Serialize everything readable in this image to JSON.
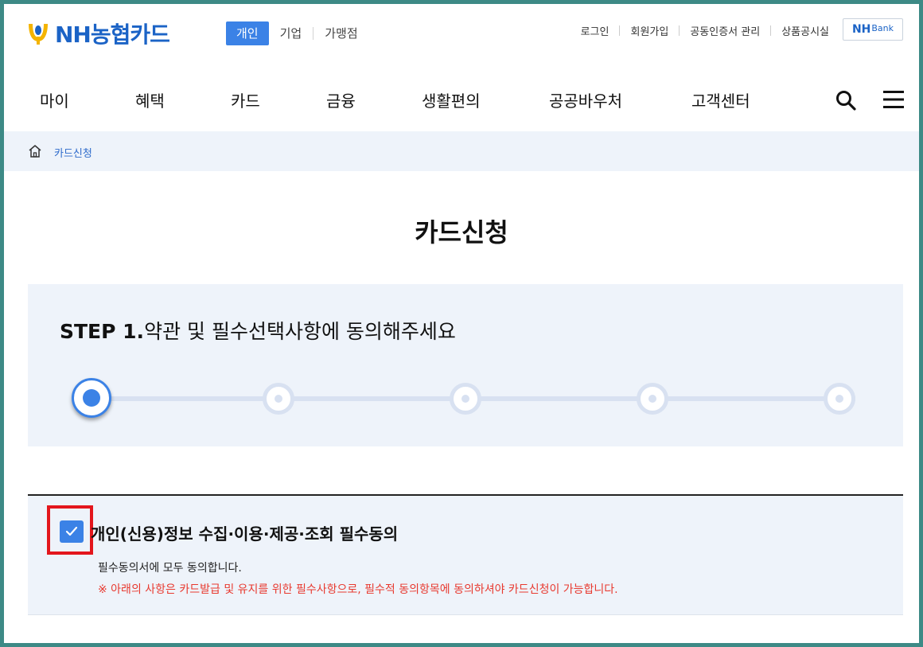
{
  "header": {
    "logo_text": "NH농협카드",
    "segments": [
      "개인",
      "기업",
      "가맹점"
    ],
    "active_segment": "개인",
    "util_links": [
      "로그인",
      "회원가입",
      "공동인증서 관리",
      "상품공시실"
    ],
    "nhbank": {
      "nh": "NH",
      "bank": "Bank"
    }
  },
  "gnb": {
    "items": [
      "마이",
      "혜택",
      "카드",
      "금융",
      "생활편의",
      "공공바우처",
      "고객센터"
    ]
  },
  "breadcrumb": {
    "current": "카드신청"
  },
  "page": {
    "title": "카드신청"
  },
  "step": {
    "label": "STEP 1.",
    "text": "약관 및 필수선택사항에 동의해주세요",
    "current": 1,
    "total": 5
  },
  "consent": {
    "checked": true,
    "title": "개인(신용)정보 수집·이용·제공·조회 필수동의",
    "description": "필수동의서에 모두 동의합니다.",
    "warning": "※ 아래의 사항은 카드발급 및 유지를 위한 필수사항으로, 필수적 동의항목에 동의하셔야 카드신청이 가능합니다."
  },
  "colors": {
    "accent": "#3b82e6",
    "brand": "#1b63c6",
    "panel_bg": "#eef3fa",
    "warning": "#e8392f",
    "highlight_border": "#e3161c",
    "frame": "#3d8a86"
  }
}
